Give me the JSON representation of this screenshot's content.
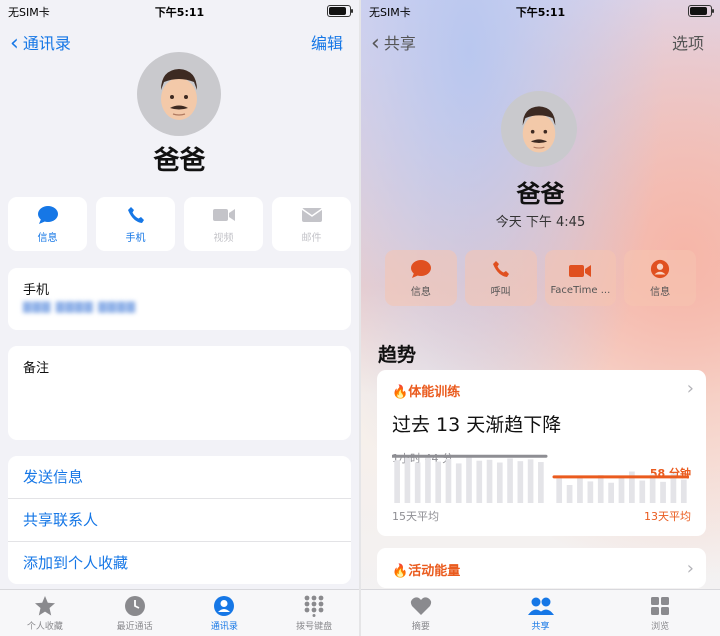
{
  "left": {
    "status": {
      "carrier": "无SIM卡",
      "time": "下午5:11"
    },
    "nav": {
      "back_label": "通讯录",
      "edit_label": "编辑"
    },
    "contact": {
      "name": "爸爸"
    },
    "actions": [
      {
        "label": "信息",
        "icon": "message-icon",
        "enabled": true
      },
      {
        "label": "手机",
        "icon": "phone-icon",
        "enabled": true
      },
      {
        "label": "视频",
        "icon": "video-icon",
        "enabled": false
      },
      {
        "label": "邮件",
        "icon": "mail-icon",
        "enabled": false
      }
    ],
    "phone_field": {
      "label": "手机"
    },
    "notes_field": {
      "label": "备注"
    },
    "links": [
      "发送信息",
      "共享联系人",
      "添加到个人收藏"
    ],
    "tabs": [
      {
        "label": "个人收藏",
        "icon": "star-icon"
      },
      {
        "label": "最近通话",
        "icon": "clock-icon"
      },
      {
        "label": "通讯录",
        "icon": "person-icon",
        "active": true
      },
      {
        "label": "拨号键盘",
        "icon": "keypad-icon"
      }
    ]
  },
  "right": {
    "status": {
      "carrier": "无SIM卡",
      "time": "下午5:11"
    },
    "nav": {
      "back_label": "共享",
      "options_label": "选项"
    },
    "contact": {
      "name": "爸爸",
      "subtitle": "今天 下午 4:45"
    },
    "actions": [
      {
        "label": "信息",
        "icon": "message-icon"
      },
      {
        "label": "呼叫",
        "icon": "phone-icon"
      },
      {
        "label": "FaceTime ...",
        "icon": "video-icon"
      },
      {
        "label": "信息",
        "icon": "person-circle-icon"
      }
    ],
    "trends_title": "趋势",
    "trend_card": {
      "category": "体能训练",
      "headline": "过去 13 天渐趋下降",
      "avg15_value": "1小时 44 分",
      "avg13_value": "58 分钟",
      "avg15_label": "15天平均",
      "avg13_label": "13天平均"
    },
    "trend_card2": {
      "category": "活动能量"
    },
    "tabs": [
      {
        "label": "摘要",
        "icon": "heart-icon"
      },
      {
        "label": "共享",
        "icon": "people-icon",
        "active": true
      },
      {
        "label": "浏览",
        "icon": "grid-icon"
      }
    ]
  },
  "chart_data": {
    "type": "bar",
    "title": "过去 13 天渐趋下降",
    "series": [
      {
        "name": "15天平均",
        "average_label": "1小时 44 分",
        "average_minutes": 104,
        "values": [
          95,
          100,
          90,
          105,
          92,
          98,
          88,
          102,
          94,
          96,
          90,
          99,
          93,
          97,
          91
        ]
      },
      {
        "name": "13天平均",
        "average_label": "58 分钟",
        "average_minutes": 58,
        "values": [
          55,
          40,
          60,
          48,
          62,
          45,
          58,
          70,
          50,
          63,
          47,
          66,
          52
        ]
      }
    ],
    "colors": {
      "past": "#8e8e93",
      "recent": "#ea5b1e"
    }
  }
}
